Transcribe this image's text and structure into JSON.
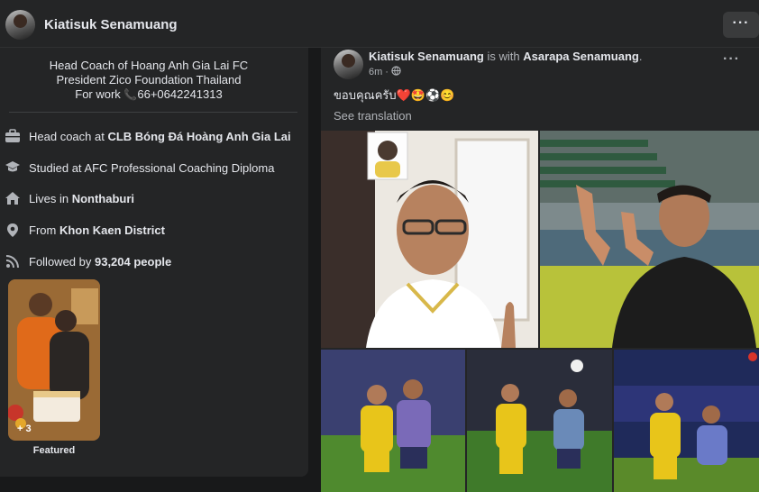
{
  "header": {
    "name": "Kiatisuk Senamuang",
    "more_label": "···"
  },
  "intro": {
    "bio": {
      "line1": "Head Coach of Hoang Anh Gia Lai FC",
      "line2": "President Zico Foundation Thailand",
      "line3_prefix": "For work ",
      "phone": "66+0642241313"
    },
    "items": [
      {
        "icon": "briefcase-icon",
        "prefix": "Head coach at ",
        "bold": "CLB Bóng Đá Hoàng Anh Gia Lai"
      },
      {
        "icon": "graduation-cap-icon",
        "prefix": "Studied at AFC Professional Coaching Diploma",
        "bold": ""
      },
      {
        "icon": "home-icon",
        "prefix": "Lives in ",
        "bold": "Nonthaburi"
      },
      {
        "icon": "location-pin-icon",
        "prefix": "From ",
        "bold": "Khon Kaen District"
      },
      {
        "icon": "rss-icon",
        "prefix": "Followed by ",
        "bold": "93,204 people"
      }
    ],
    "featured": {
      "count": "+ 3",
      "label": "Featured"
    }
  },
  "post": {
    "author": "Kiatisuk Senamuang",
    "with_text": " is with ",
    "tagged": "Asarapa Senamuang",
    "suffix": ".",
    "time": "6m",
    "dot": "·",
    "more_label": "···",
    "text": "ขอบคุณครับ",
    "emojis": "❤️🤩⚽😊",
    "see_translation": "See translation"
  },
  "colors": {
    "background": "#18191a",
    "card": "#242526",
    "text_primary": "#e4e6eb",
    "text_secondary": "#b0b3b8",
    "phone_icon": "#e03c31"
  }
}
